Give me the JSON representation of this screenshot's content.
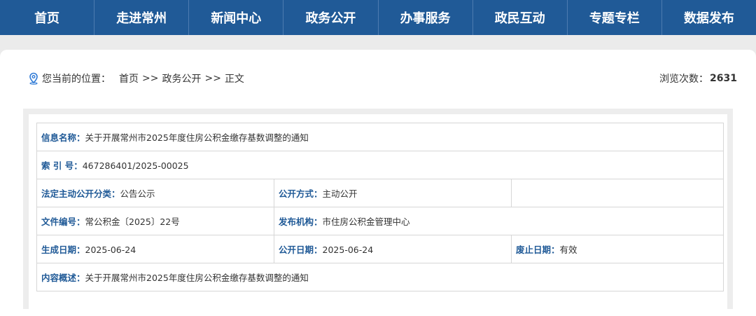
{
  "nav": {
    "items": [
      "首页",
      "走进常州",
      "新闻中心",
      "政务公开",
      "办事服务",
      "政民互动",
      "专题专栏",
      "数据发布"
    ]
  },
  "breadcrumb": {
    "icon": "location-pin-icon",
    "label": "您当前的位置：",
    "items": [
      "首页",
      "政务公开",
      "正文"
    ],
    "separator": ">>"
  },
  "views": {
    "label": "浏览次数：",
    "count": "2631"
  },
  "info": {
    "name_label": "信息名称：",
    "name_value": "关于开展常州市2025年度住房公积金缴存基数调整的通知",
    "index_label": "索 引 号：",
    "index_value": "467286401/2025-00025",
    "category_label": "法定主动公开分类：",
    "category_value": "公告公示",
    "method_label": "公开方式：",
    "method_value": "主动公开",
    "doc_no_label": "文件编号：",
    "doc_no_value": "常公积金〔2025〕22号",
    "publisher_label": "发布机构：",
    "publisher_value": "市住房公积金管理中心",
    "created_label": "生成日期：",
    "created_value": "2025-06-24",
    "published_label": "公开日期：",
    "published_value": "2025-06-24",
    "abolished_label": "废止日期：",
    "abolished_value": "有效",
    "summary_label": "内容概述：",
    "summary_value": "关于开展常州市2025年度住房公积金缴存基数调整的通知"
  },
  "colors": {
    "nav_bg": "#205a97",
    "label_blue": "#205a97",
    "page_bg": "#ebebeb"
  }
}
